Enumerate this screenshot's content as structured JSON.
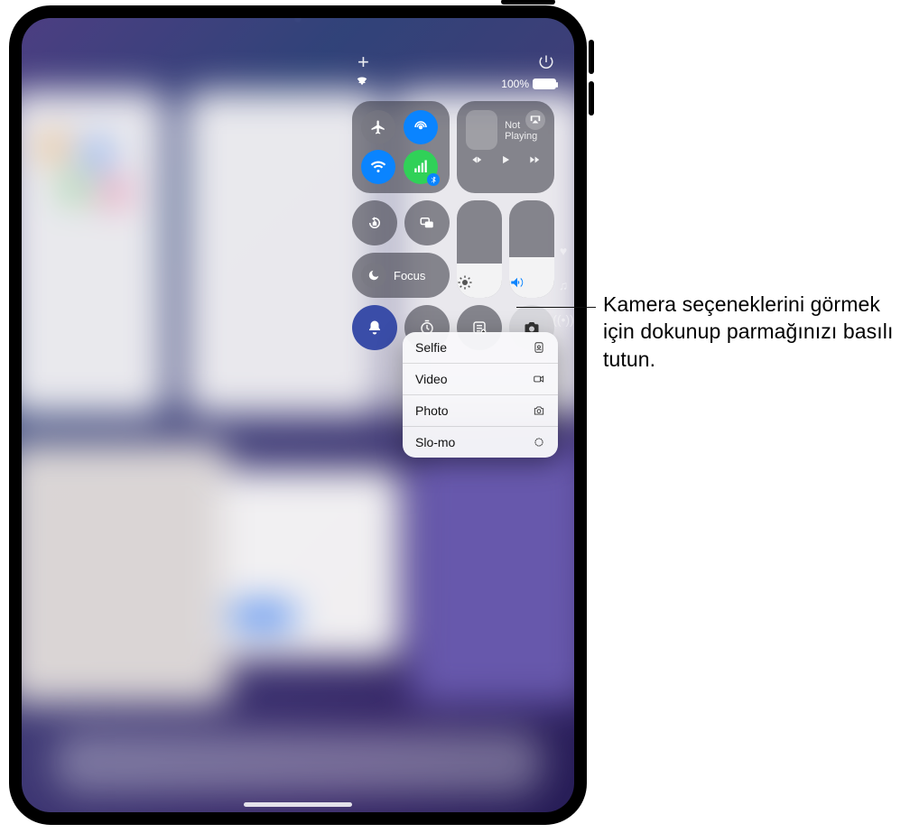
{
  "status": {
    "battery_percent": "100%"
  },
  "control_center": {
    "not_playing": "Not Playing",
    "focus_label": "Focus"
  },
  "context_menu": {
    "items": [
      {
        "label": "Selfie"
      },
      {
        "label": "Video"
      },
      {
        "label": "Photo"
      },
      {
        "label": "Slo-mo"
      }
    ]
  },
  "callout": {
    "text": "Kamera seçeneklerini görmek için dokunup parmağınızı basılı tutun."
  }
}
